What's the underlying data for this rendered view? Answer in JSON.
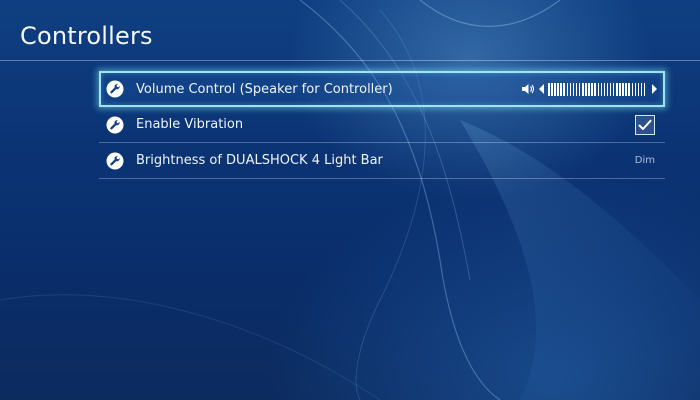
{
  "header": {
    "title": "Controllers"
  },
  "settings": [
    {
      "label": "Volume Control (Speaker for Controller)",
      "icon": "wrench-icon",
      "control": "volume-slider",
      "volume_level": 1.0
    },
    {
      "label": "Enable Vibration",
      "icon": "wrench-icon",
      "control": "checkbox",
      "checked": true
    },
    {
      "label": "Brightness of DUALSHOCK 4 Light Bar",
      "icon": "wrench-icon",
      "control": "value",
      "value": "Dim"
    }
  ],
  "colors": {
    "background": "#0b3475",
    "focus_outline": "#9fe4f4",
    "text": "#ffffff",
    "secondary_text": "#aebfd6"
  }
}
